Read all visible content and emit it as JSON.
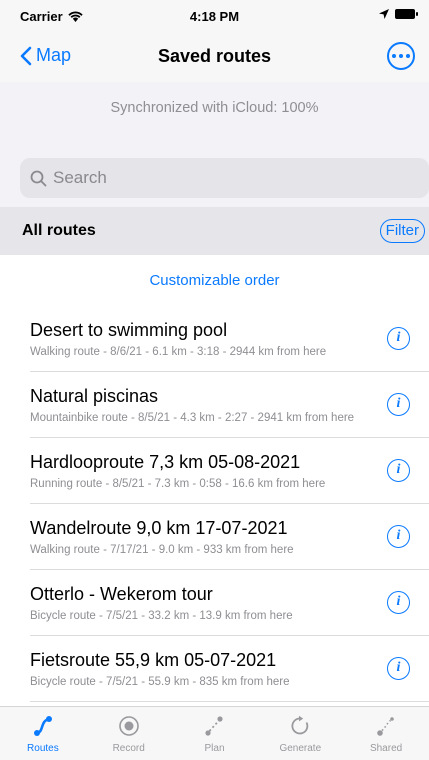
{
  "status_bar": {
    "carrier": "Carrier",
    "time": "4:18 PM"
  },
  "nav": {
    "back_label": "Map",
    "title": "Saved routes"
  },
  "sync": {
    "text": "Synchronized with iCloud: 100%"
  },
  "search": {
    "placeholder": "Search"
  },
  "section": {
    "title": "All routes",
    "filter_label": "Filter"
  },
  "order_link": "Customizable order",
  "routes": [
    {
      "name": "Desert to swimming pool",
      "meta": "Walking route - 8/6/21 - 6.1 km - 3:18 - 2944 km from here"
    },
    {
      "name": "Natural piscinas",
      "meta": "Mountainbike route - 8/5/21 - 4.3 km - 2:27 - 2941 km from here"
    },
    {
      "name": "Hardlooproute 7,3 km 05-08-2021",
      "meta": "Running route - 8/5/21 - 7.3 km - 0:58 - 16.6 km from here"
    },
    {
      "name": "Wandelroute 9,0 km 17-07-2021",
      "meta": "Walking route - 7/17/21 - 9.0 km - 933 km from here"
    },
    {
      "name": "Otterlo - Wekerom tour",
      "meta": "Bicycle route - 7/5/21 - 33.2 km - 13.9 km from here"
    },
    {
      "name": "Fietsroute 55,9 km 05-07-2021",
      "meta": "Bicycle route - 7/5/21 - 55.9 km - 835 km from here"
    }
  ],
  "tabs": [
    {
      "label": "Routes",
      "icon": "route-icon",
      "active": true
    },
    {
      "label": "Record",
      "icon": "record-icon",
      "active": false
    },
    {
      "label": "Plan",
      "icon": "plan-icon",
      "active": false
    },
    {
      "label": "Generate",
      "icon": "generate-icon",
      "active": false
    },
    {
      "label": "Shared",
      "icon": "shared-icon",
      "active": false
    }
  ],
  "colors": {
    "accent": "#0a7aff",
    "secondary_text": "#8e8e93",
    "inactive_tab": "#9a9a9e"
  }
}
